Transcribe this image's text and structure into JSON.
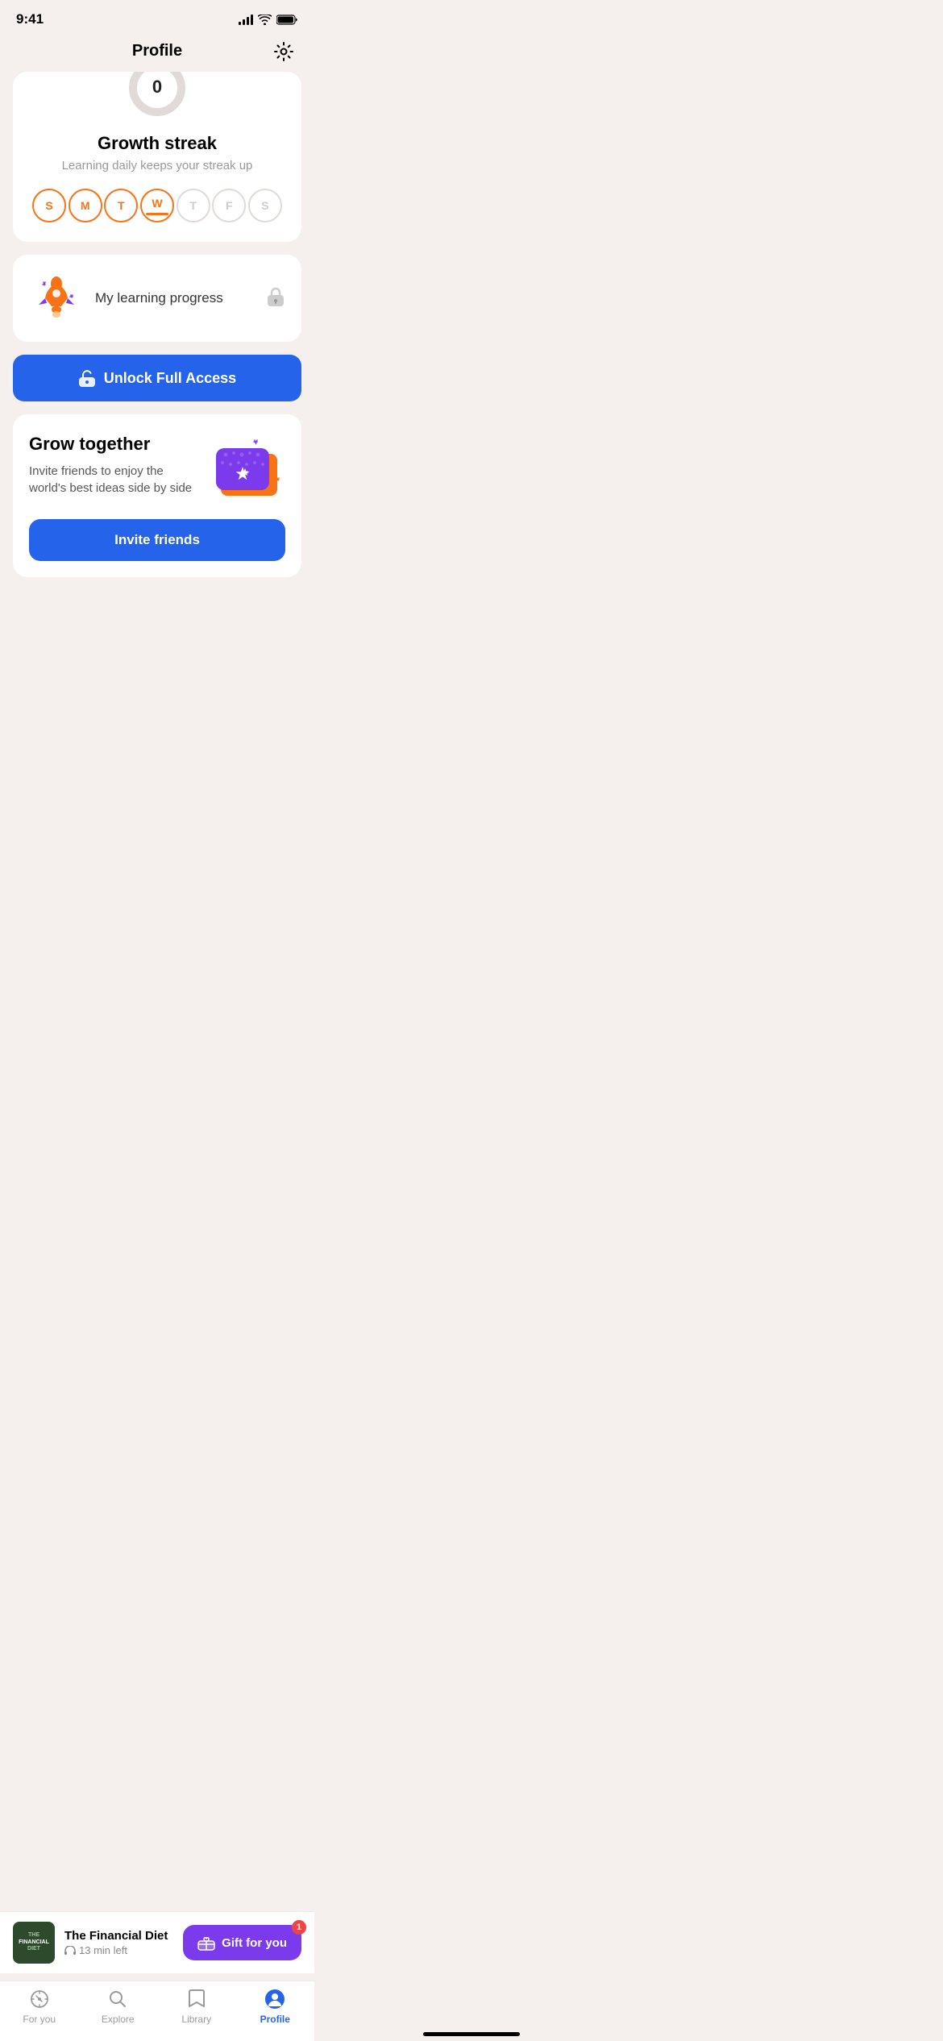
{
  "statusBar": {
    "time": "9:41",
    "signalBars": [
      4,
      7,
      10,
      13,
      16
    ],
    "battery": "100"
  },
  "header": {
    "title": "Profile",
    "gearLabel": "settings"
  },
  "streakCard": {
    "title": "Growth streak",
    "subtitle": "Learning daily keeps your streak up",
    "days": [
      {
        "label": "S",
        "state": "completed"
      },
      {
        "label": "M",
        "state": "completed"
      },
      {
        "label": "T",
        "state": "completed"
      },
      {
        "label": "W",
        "state": "active"
      },
      {
        "label": "T",
        "state": "inactive"
      },
      {
        "label": "F",
        "state": "inactive"
      },
      {
        "label": "S",
        "state": "inactive"
      }
    ],
    "donut": {
      "value": 0,
      "total": 100,
      "color": "#f97316",
      "grayColor": "#e0dbd8"
    }
  },
  "progressCard": {
    "label": "My learning progress",
    "locked": true
  },
  "unlockButton": {
    "label": "Unlock Full Access"
  },
  "growCard": {
    "title": "Grow together",
    "subtitle": "Invite friends to enjoy the world's best ideas side by side",
    "inviteLabel": "Invite friends"
  },
  "miniPlayer": {
    "bookTitle": "The Financial Diet",
    "bookThumbLine1": "THE",
    "bookThumbLine2": "FINANCIAL",
    "bookThumbLine3": "DIET",
    "timeLeft": "13 min left",
    "giftLabel": "Gift for you",
    "giftBadge": "1"
  },
  "bottomNav": {
    "items": [
      {
        "label": "For you",
        "icon": "compass",
        "active": false
      },
      {
        "label": "Explore",
        "icon": "search",
        "active": false
      },
      {
        "label": "Library",
        "icon": "bookmark",
        "active": false
      },
      {
        "label": "Profile",
        "icon": "person",
        "active": true
      }
    ]
  }
}
